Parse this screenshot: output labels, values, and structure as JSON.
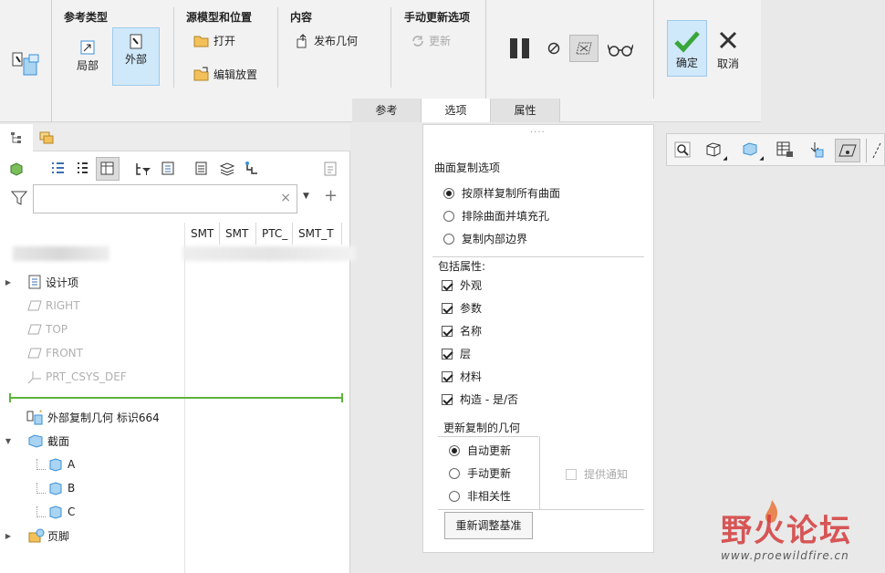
{
  "ribbon": {
    "group_ref_type": {
      "title": "参考类型",
      "local": "局部",
      "external": "外部"
    },
    "group_source": {
      "title": "源模型和位置",
      "open": "打开",
      "edit_placement": "编辑放置"
    },
    "group_content": {
      "title": "内容",
      "publish_geometry": "发布几何"
    },
    "group_manual": {
      "title": "手动更新选项",
      "update": "更新"
    },
    "ok": "确定",
    "cancel": "取消"
  },
  "tabs": [
    "参考",
    "选项",
    "属性"
  ],
  "tree": {
    "search_placeholder": "",
    "columns": [
      "SMT",
      "SMT",
      "PTC_",
      "SMT_T"
    ],
    "items": [
      {
        "label": "设计项",
        "gray": false
      },
      {
        "label": "RIGHT",
        "gray": true
      },
      {
        "label": "TOP",
        "gray": true
      },
      {
        "label": "FRONT",
        "gray": true
      },
      {
        "label": "PRT_CSYS_DEF",
        "gray": true
      },
      {
        "label": "外部复制几何 标识664",
        "gray": false
      },
      {
        "label": "截面",
        "gray": false
      },
      {
        "label": "A",
        "gray": false
      },
      {
        "label": "B",
        "gray": false
      },
      {
        "label": "C",
        "gray": false
      },
      {
        "label": "页脚",
        "gray": false
      }
    ]
  },
  "options": {
    "surface_copy_title": "曲面复制选项",
    "surface_copy": [
      "按原样复制所有曲面",
      "排除曲面并填充孔",
      "复制内部边界"
    ],
    "include_attrs_title": "包括属性:",
    "attrs": [
      "外观",
      "参数",
      "名称",
      "层",
      "材料",
      "构造 - 是/否"
    ],
    "update_title": "更新复制的几何",
    "update_opts": [
      "自动更新",
      "手动更新",
      "非相关性"
    ],
    "notify": "提供通知",
    "realign_button": "重新调整基准"
  },
  "watermark": {
    "logo_text": "野火论坛",
    "url": "www.proewildfire.cn"
  },
  "colors": {
    "accent": "#3a8fd6",
    "ok_green": "#3aa63a",
    "selected_bg": "#cfe8fa",
    "green_line": "#5db33a"
  }
}
